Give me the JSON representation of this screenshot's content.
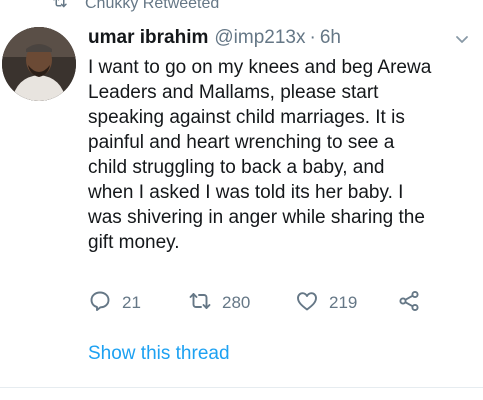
{
  "retweet_context": {
    "label": "Chukky Retweeted",
    "icon": "retweet-icon"
  },
  "tweet": {
    "author": {
      "display_name": "umar ibrahim",
      "handle": "@imp213x",
      "separator": "·",
      "timestamp": "6h",
      "avatar_icon": "avatar"
    },
    "text": "I want to go on my knees and beg Arewa\nLeaders and Mallams, please start\nspeaking against child marriages. It is\npainful and heart wrenching to see a\nchild struggling to back a baby, and\nwhen I asked I was told its her baby. I\nwas shivering in anger while sharing the\ngift money.",
    "actions": {
      "reply_count": "21",
      "retweet_count": "280",
      "like_count": "219"
    },
    "show_thread_label": "Show this thread"
  },
  "colors": {
    "text": "#14171a",
    "secondary": "#657786",
    "accent": "#1da1f2",
    "divider": "#e6ecf0"
  }
}
